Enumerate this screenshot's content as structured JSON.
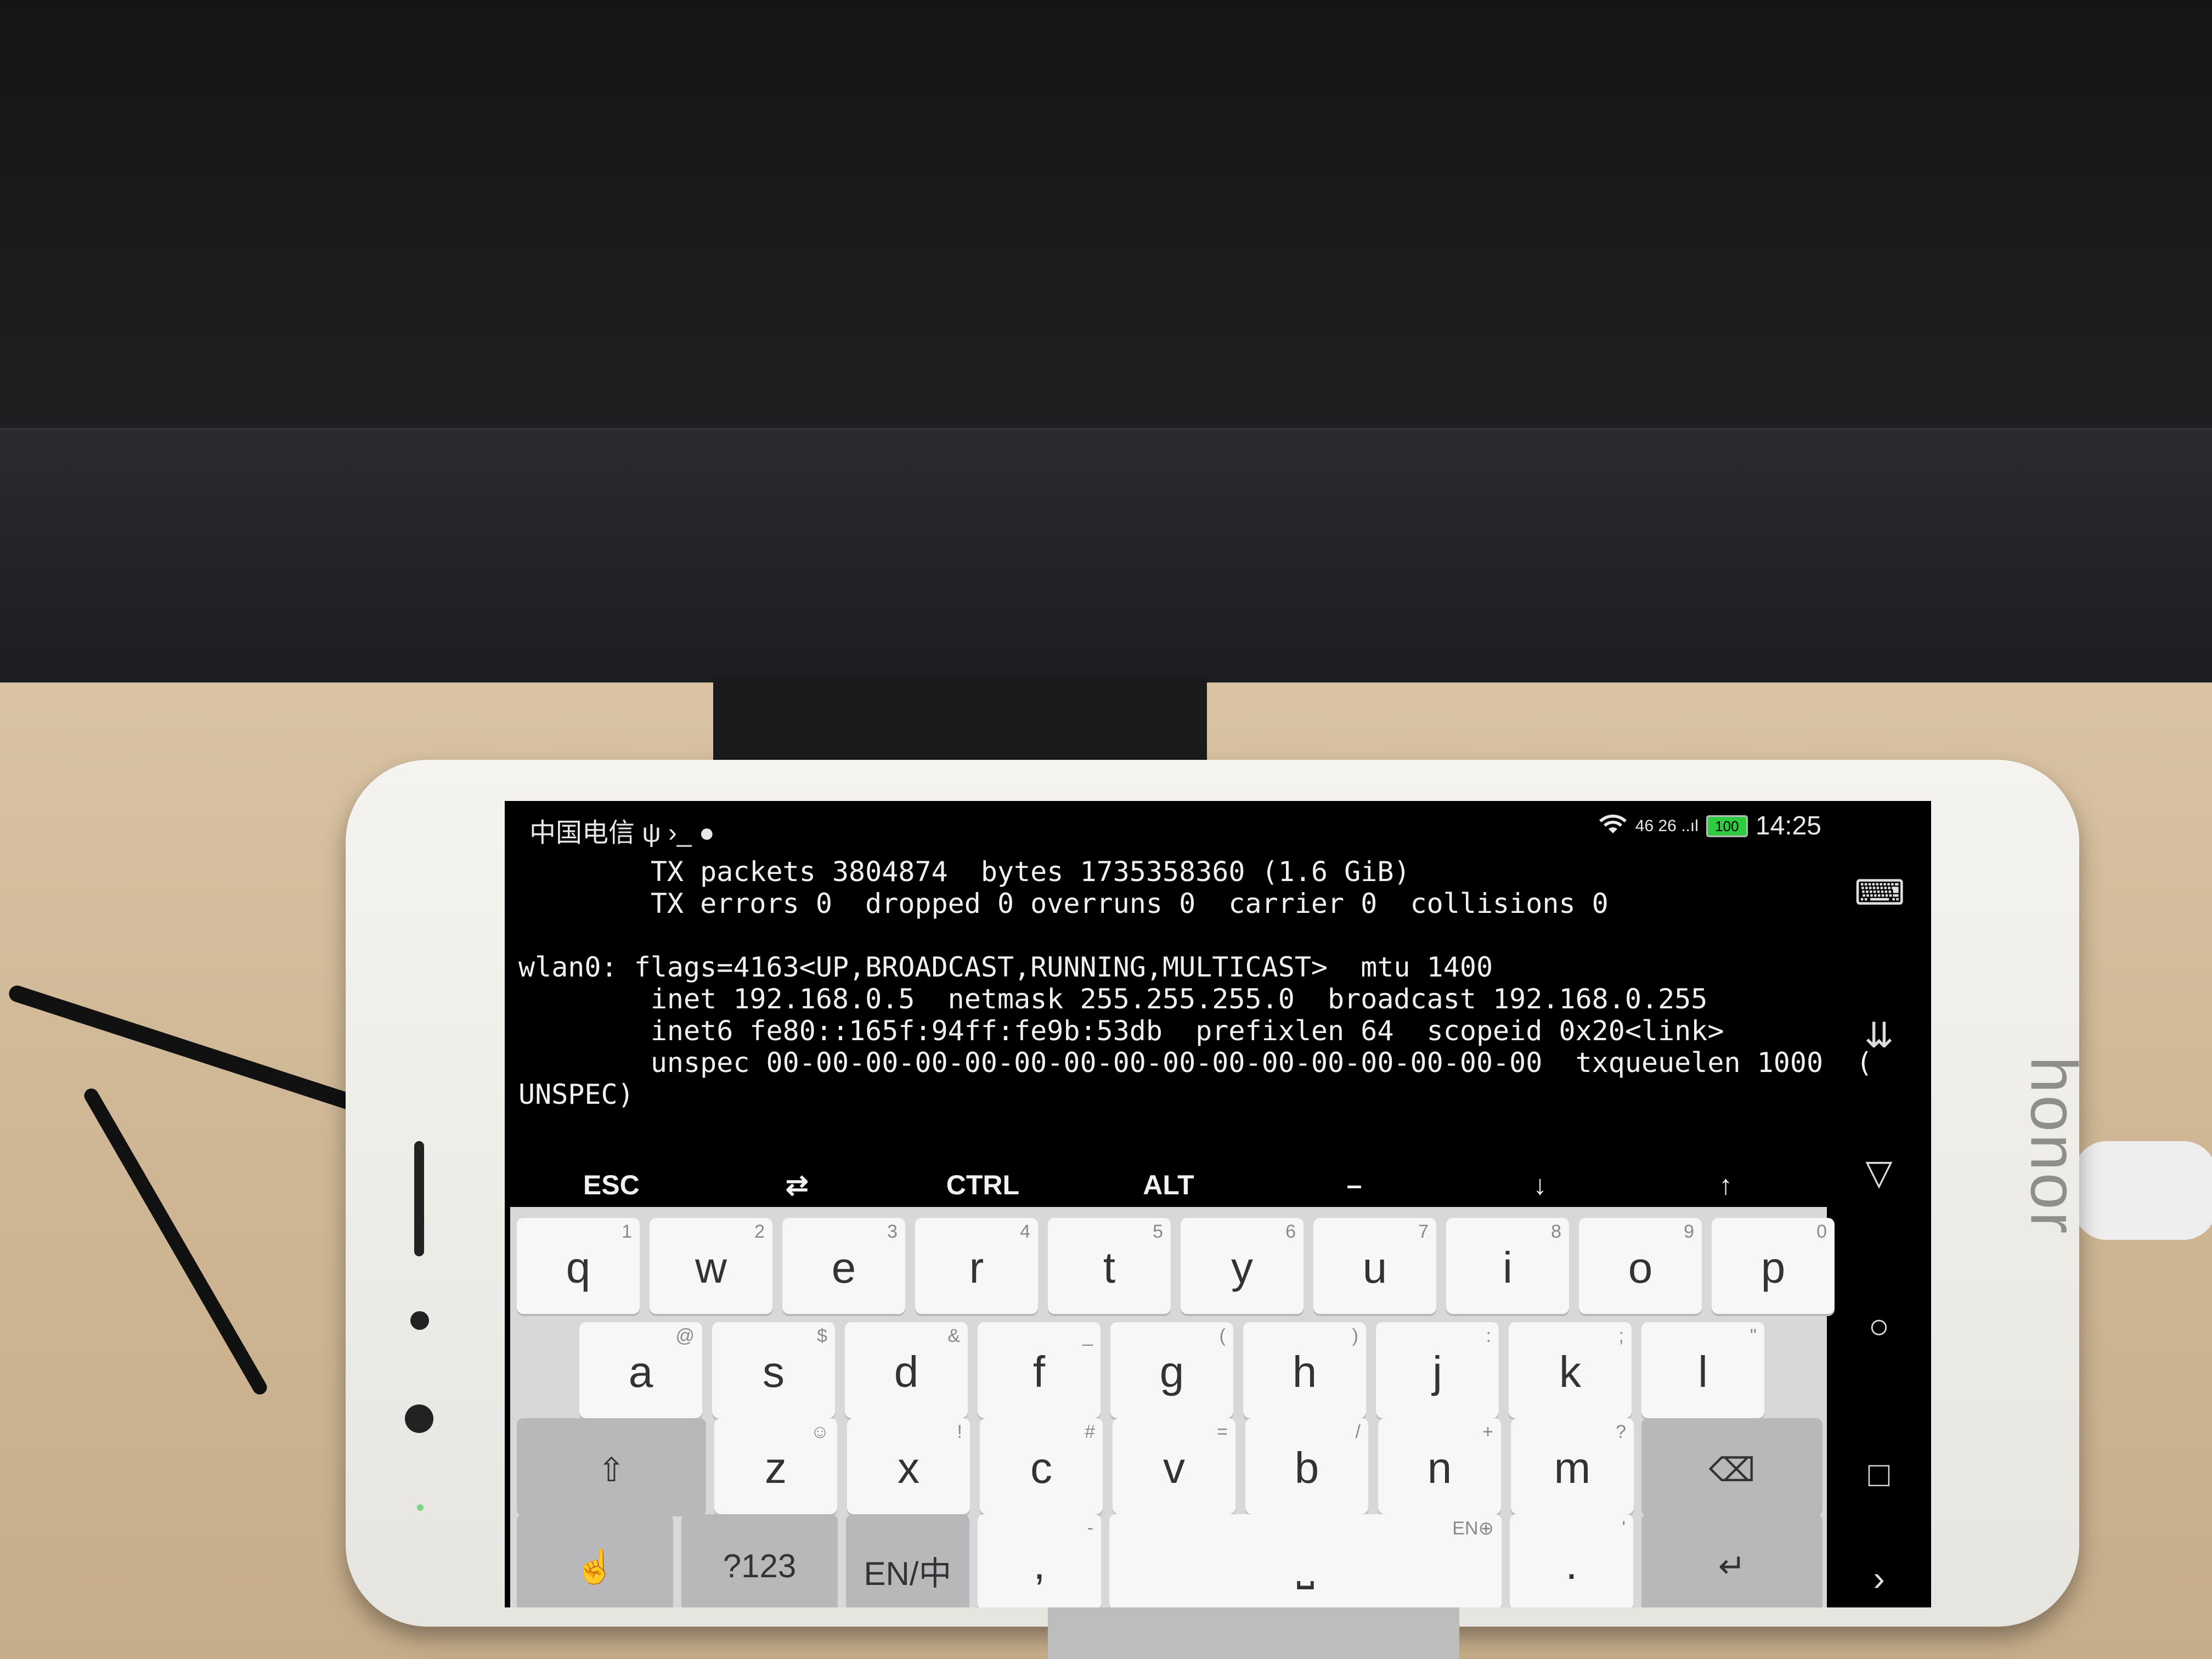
{
  "status_bar": {
    "carrier": "中国电信 ψ ›_ ●",
    "signal": "46 26 ..ıl",
    "battery": "100",
    "time": "14:25"
  },
  "terminal": {
    "lines": [
      "        TX packets 3804874  bytes 1735358360 (1.6 GiB)",
      "        TX errors 0  dropped 0 overruns 0  carrier 0  collisions 0",
      "",
      "wlan0: flags=4163<UP,BROADCAST,RUNNING,MULTICAST>  mtu 1400",
      "        inet 192.168.0.5  netmask 255.255.255.0  broadcast 192.168.0.255",
      "        inet6 fe80::165f:94ff:fe9b:53db  prefixlen 64  scopeid 0x20<link>",
      "        unspec 00-00-00-00-00-00-00-00-00-00-00-00-00-00-00-00  txqueuelen 1000  (",
      "UNSPEC)"
    ]
  },
  "extra_keys": [
    "ESC",
    "⇄",
    "CTRL",
    "ALT",
    "–",
    "↓",
    "↑"
  ],
  "nav": {
    "keyboard_icon": "⌨",
    "collapse_icon": "⇊",
    "back_icon": "▽",
    "home_icon": "○",
    "recent_icon": "□",
    "more_icon": "›"
  },
  "keyboard": {
    "row1": [
      {
        "k": "q",
        "h": "1"
      },
      {
        "k": "w",
        "h": "2"
      },
      {
        "k": "e",
        "h": "3"
      },
      {
        "k": "r",
        "h": "4"
      },
      {
        "k": "t",
        "h": "5"
      },
      {
        "k": "y",
        "h": "6"
      },
      {
        "k": "u",
        "h": "7"
      },
      {
        "k": "i",
        "h": "8"
      },
      {
        "k": "o",
        "h": "9"
      },
      {
        "k": "p",
        "h": "0"
      }
    ],
    "row2": [
      {
        "k": "a",
        "h": "@"
      },
      {
        "k": "s",
        "h": "$"
      },
      {
        "k": "d",
        "h": "&"
      },
      {
        "k": "f",
        "h": "_"
      },
      {
        "k": "g",
        "h": "("
      },
      {
        "k": "h",
        "h": ")"
      },
      {
        "k": "j",
        "h": ":"
      },
      {
        "k": "k",
        "h": ";"
      },
      {
        "k": "l",
        "h": "\""
      }
    ],
    "row3": [
      {
        "k": "z",
        "h": "☺"
      },
      {
        "k": "x",
        "h": "!"
      },
      {
        "k": "c",
        "h": "#"
      },
      {
        "k": "v",
        "h": "="
      },
      {
        "k": "b",
        "h": "/"
      },
      {
        "k": "n",
        "h": "+"
      },
      {
        "k": "m",
        "h": "?"
      }
    ],
    "shift": "⇧",
    "backspace": "⌫",
    "gesture": "☝",
    "numbers": "?123",
    "lang": "EN/中",
    "comma": ",",
    "comma_hint": "-",
    "space_hint": "EN⊕",
    "space": "⎵",
    "period": ".",
    "period_hint": "'",
    "enter": "↵"
  },
  "brand": "honor"
}
